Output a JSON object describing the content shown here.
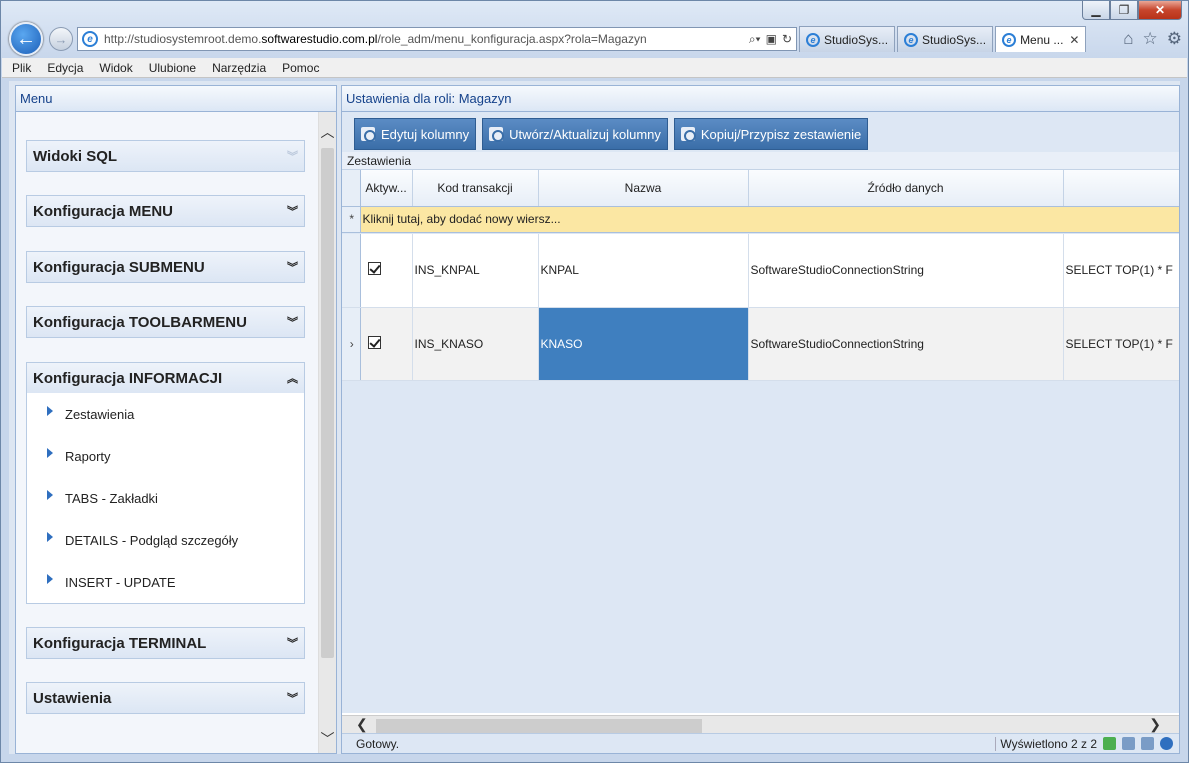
{
  "browser": {
    "url_prefix": "http://studiosystemroot.demo.",
    "url_domain": "softwarestudio.com.pl",
    "url_path": "/role_adm/menu_konfiguracja.aspx?rola=Magazyn",
    "tabs": [
      {
        "label": "StudioSys..."
      },
      {
        "label": "StudioSys..."
      },
      {
        "label": "Menu ..."
      }
    ],
    "menu": [
      "Plik",
      "Edycja",
      "Widok",
      "Ulubione",
      "Narzędzia",
      "Pomoc"
    ]
  },
  "left_panel": {
    "title": "Menu",
    "groups": [
      {
        "label": "Widoki SQL"
      },
      {
        "label": "Konfiguracja MENU"
      },
      {
        "label": "Konfiguracja SUBMENU"
      },
      {
        "label": "Konfiguracja TOOLBARMENU"
      },
      {
        "label": "Konfiguracja INFORMACJI"
      },
      {
        "label": "Konfiguracja TERMINAL"
      },
      {
        "label": "Ustawienia"
      }
    ],
    "sub_items": [
      {
        "label": "Zestawienia"
      },
      {
        "label": "Raporty"
      },
      {
        "label": "TABS - Zakładki"
      },
      {
        "label": "DETAILS - Podgląd szczegóły"
      },
      {
        "label": "INSERT - UPDATE"
      }
    ]
  },
  "right_panel": {
    "title": "Ustawienia dla roli: Magazyn",
    "toolbar": {
      "edit_columns": "Edytuj kolumny",
      "create_update_columns": "Utwórz/Aktualizuj kolumny",
      "copy_assign": "Kopiuj/Przypisz zestawienie"
    },
    "grid_title": "Zestawienia",
    "columns": [
      "Aktyw...",
      "Kod transakcji",
      "Nazwa",
      "Źródło danych",
      ""
    ],
    "new_row_text": "Kliknij tutaj, aby dodać nowy wiersz...",
    "rows": [
      {
        "active": true,
        "code": "INS_KNPAL",
        "name": "KNPAL",
        "source": "SoftwareStudioConnectionString",
        "sql": "SELECT TOP(1) * F"
      },
      {
        "active": true,
        "code": "INS_KNASO",
        "name": "KNASO",
        "source": "SoftwareStudioConnectionString",
        "sql": "SELECT TOP(1) * F"
      }
    ],
    "status": "Gotowy.",
    "count_text": "Wyświetlono 2 z 2"
  }
}
